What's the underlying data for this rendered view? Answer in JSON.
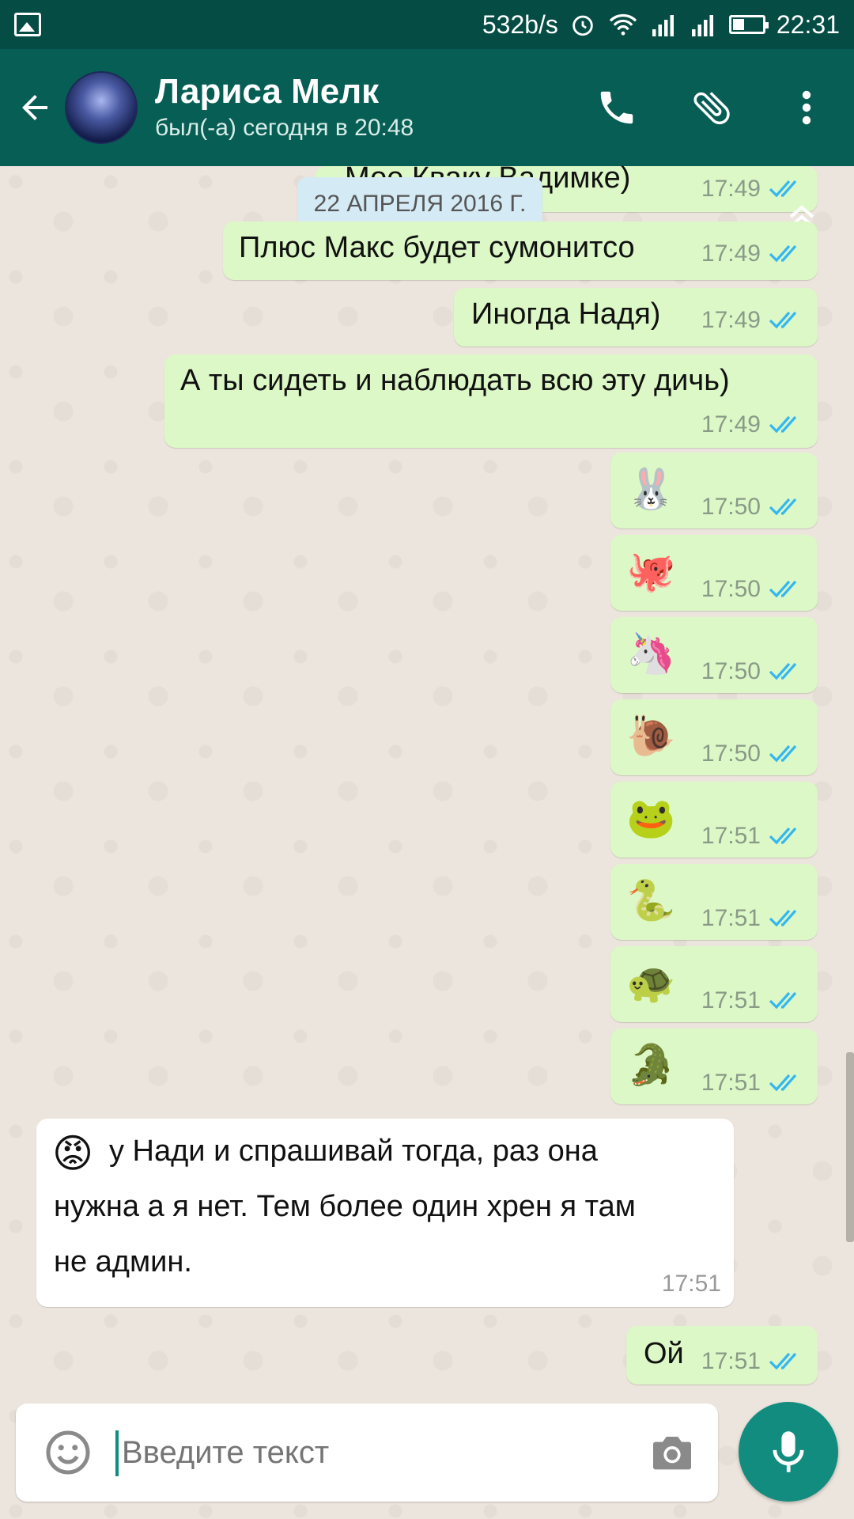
{
  "status_bar": {
    "speed": "532b/s",
    "time": "22:31",
    "icons": [
      "gallery-icon",
      "alarm-icon",
      "wifi-icon",
      "signal-icon",
      "signal-icon",
      "battery-icon"
    ]
  },
  "header": {
    "contact_name": "Лариса Мелк",
    "last_seen": "был(-а) сегодня в 20:48",
    "icons": [
      "back-arrow-icon",
      "phone-icon",
      "paperclip-icon",
      "more-vert-icon"
    ]
  },
  "chat": {
    "date_chip": "22 АПРЕЛЯ 2016 Г.",
    "partial_top": {
      "text": "Мое Кваку Вадимке)",
      "time": "17:49"
    },
    "messages": [
      {
        "dir": "out",
        "text": "Плюс Макс будет сумонитсо",
        "time": "17:49"
      },
      {
        "dir": "out",
        "text": "Иногда Надя)",
        "time": "17:49"
      },
      {
        "dir": "out",
        "text": "А ты сидеть и наблюдать всю эту дичь)",
        "time": "17:49"
      },
      {
        "dir": "out",
        "emoji": "🐰",
        "time": "17:50"
      },
      {
        "dir": "out",
        "emoji": "🐙",
        "time": "17:50"
      },
      {
        "dir": "out",
        "emoji": "🦄",
        "time": "17:50"
      },
      {
        "dir": "out",
        "emoji": "🐌",
        "time": "17:50"
      },
      {
        "dir": "out",
        "emoji": "🐸",
        "time": "17:51"
      },
      {
        "dir": "out",
        "emoji": "🐍",
        "time": "17:51"
      },
      {
        "dir": "out",
        "emoji": "🐢",
        "time": "17:51"
      },
      {
        "dir": "out",
        "emoji": "🐊",
        "time": "17:51"
      },
      {
        "dir": "in",
        "emoji": "😡",
        "lines": [
          "у Нади и спрашивай тогда, раз она",
          "нужна а я нет. Тем более один хрен я там",
          "не админ."
        ],
        "time": "17:51"
      },
      {
        "dir": "out",
        "text": "Ой",
        "time": "17:51"
      }
    ]
  },
  "composer": {
    "placeholder": "Введите текст",
    "icons": [
      "emoji-icon",
      "camera-icon",
      "mic-icon"
    ]
  },
  "colors": {
    "app_bar": "#075e54",
    "status_bar": "#054d44",
    "outgoing_bubble": "#dcf8c6",
    "incoming_bubble": "#ffffff",
    "read_ticks": "#34b7f1",
    "fab": "#128c7e"
  }
}
